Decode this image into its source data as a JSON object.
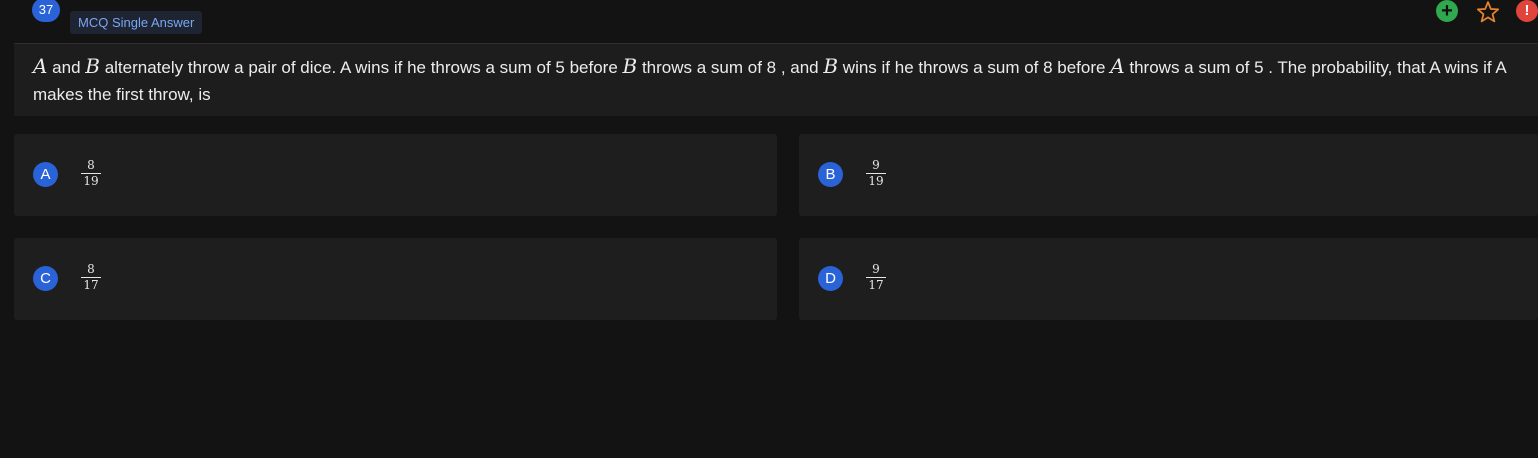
{
  "header": {
    "question_number": "37",
    "question_type": "MCQ Single Answer",
    "icons": {
      "add": "plus-circle-icon",
      "bookmark": "star-icon",
      "report": "alert-circle-icon"
    },
    "colors": {
      "accent": "#2a63d8",
      "add": "#2fa84f",
      "bookmark": "#e8862e",
      "report": "#e0443a"
    }
  },
  "question": {
    "var_a": "A",
    "seg1": " and ",
    "var_b": "B",
    "seg2": " alternately throw a pair of dice. A wins if he throws a sum of 5 before ",
    "var_b2": "B",
    "seg3": " throws a sum of 8 , and ",
    "var_b3": "B",
    "seg4": " wins if he throws a sum of 8 before ",
    "var_a2": "A",
    "seg5": " throws a sum of 5 . The probability, that A wins if A makes the first throw, is"
  },
  "options": [
    {
      "label": "A",
      "numerator": "8",
      "denominator": "19"
    },
    {
      "label": "B",
      "numerator": "9",
      "denominator": "19"
    },
    {
      "label": "C",
      "numerator": "8",
      "denominator": "17"
    },
    {
      "label": "D",
      "numerator": "9",
      "denominator": "17"
    }
  ]
}
